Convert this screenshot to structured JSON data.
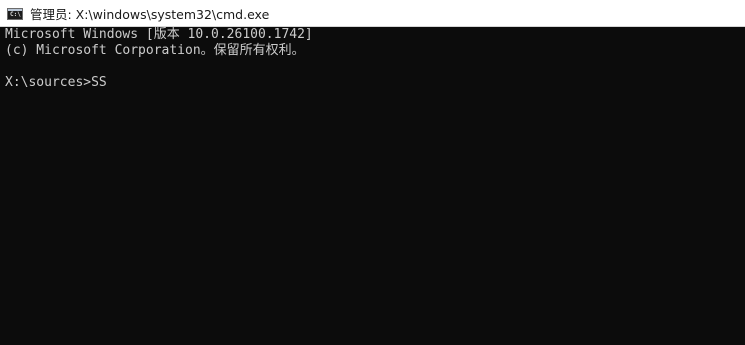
{
  "window": {
    "title": "管理员: X:\\windows\\system32\\cmd.exe",
    "icon": "cmd-prompt-icon",
    "icon_glyph": "C:\\"
  },
  "console": {
    "lines": [
      "Microsoft Windows [版本 10.0.26100.1742]",
      "(c) Microsoft Corporation。保留所有权利。",
      ""
    ],
    "prompt": "X:\\sources>",
    "input": "SS"
  },
  "colors": {
    "console_background": "#0c0c0c",
    "console_text": "#cccccc",
    "titlebar_background": "#ffffff"
  }
}
